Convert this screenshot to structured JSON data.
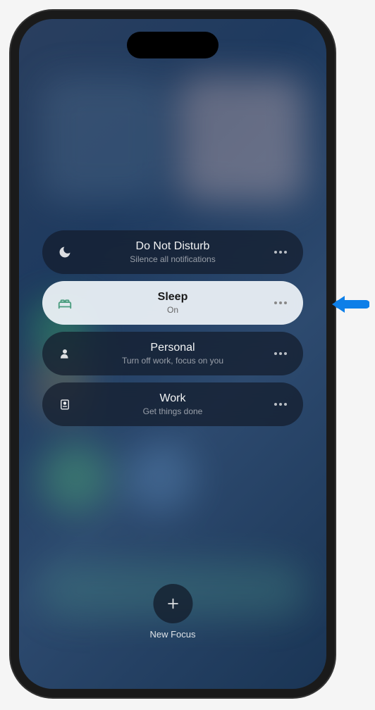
{
  "focus_modes": [
    {
      "title": "Do Not Disturb",
      "subtitle": "Silence all notifications",
      "icon": "moon",
      "active": false
    },
    {
      "title": "Sleep",
      "subtitle": "On",
      "icon": "bed",
      "active": true
    },
    {
      "title": "Personal",
      "subtitle": "Turn off work, focus on you",
      "icon": "person",
      "active": false
    },
    {
      "title": "Work",
      "subtitle": "Get things done",
      "icon": "badge",
      "active": false
    }
  ],
  "new_focus": {
    "label": "New Focus"
  }
}
